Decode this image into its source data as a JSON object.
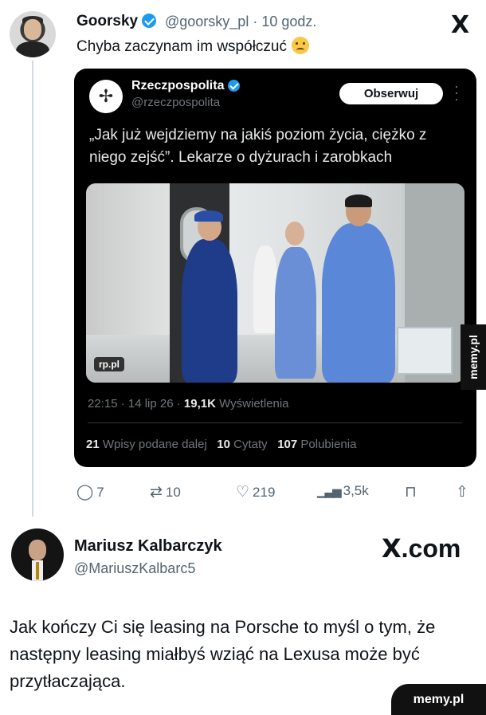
{
  "outer_tweet": {
    "name": "Goorsky",
    "handle": "@goorsky_pl · 10 godz.",
    "text": "Chyba zaczynam im współczuć",
    "x_logo": "X"
  },
  "quoted_tweet": {
    "name": "Rzeczpospolita",
    "handle": "@rzeczpospolita",
    "follow_label": "Obserwuj",
    "text": "„Jak już wejdziemy na jakiś poziom życia, ciężko z niego zejść”. Lekarze o dyżurach i zarobkach",
    "image_badge": "rp.pl",
    "meta_prefix": "22:15 · 14 lip 26 · ",
    "views_value": "19,1K",
    "views_label": "Wyświetlenia",
    "reposts_value": "21",
    "reposts_label": "Wpisy podane dalej",
    "quotes_value": "10",
    "quotes_label": "Cytaty",
    "likes_value": "107",
    "likes_label": "Polubienia"
  },
  "actions": {
    "replies": "7",
    "retweets": "10",
    "likes": "219",
    "views": "3,5k"
  },
  "second_post": {
    "name": "Mariusz Kalbarczyk",
    "handle": "@MariuszKalbarc5",
    "brand": ".com",
    "brand_mark": "X",
    "text": "Jak kończy Ci się leasing na Porsche to myśl o tym, że następny leasing miałbyś wziąć na Lexusa może być przytłaczająca."
  },
  "watermarks": {
    "side": "memy.pl",
    "bottom": "memy.pl"
  },
  "icons": [
    "verified-icon",
    "sad-emoji-icon",
    "reply-icon",
    "retweet-icon",
    "like-icon",
    "views-icon",
    "bookmark-icon",
    "share-icon",
    "more-icon"
  ],
  "colors": {
    "verified": "#1d9bf0",
    "card_bg": "#000000",
    "muted": "#536471"
  }
}
